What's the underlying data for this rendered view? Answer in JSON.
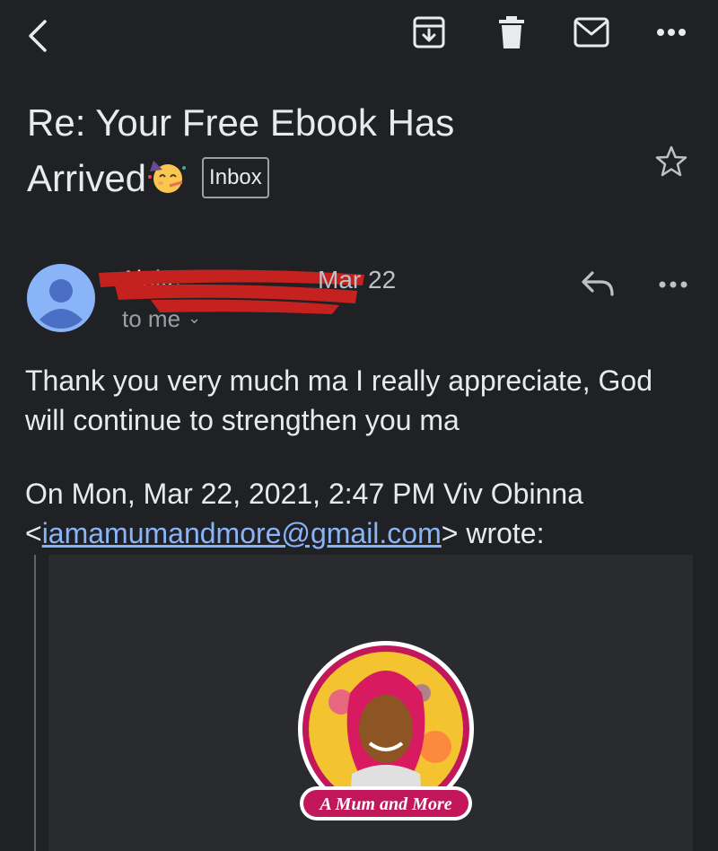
{
  "toolbar": {
    "back_icon": "chevron-left-icon",
    "archive_icon": "archive-icon",
    "delete_icon": "trash-icon",
    "mark_unread_icon": "mail-icon",
    "more_icon": "more-horizontal-icon"
  },
  "subject": {
    "line1": "Re: Your Free Ebook Has",
    "line2": "Arrived",
    "emoji": "partying-face-emoji",
    "label": "Inbox",
    "star_icon": "star-outline-icon"
  },
  "message": {
    "sender_name": "Ajoke",
    "sender_redacted": true,
    "date": "Mar 22",
    "to": "to me",
    "reply_icon": "reply-icon",
    "more_icon": "more-horizontal-icon",
    "body": "Thank you very much ma I really appreciate, God will continue to strengthen you ma",
    "quote_intro": "On Mon, Mar 22, 2021, 2:47 PM Viv Obinna",
    "quote_lt": "<",
    "quote_email": "iamamumandmore@gmail.com",
    "quote_gt_wrote": "> wrote:"
  },
  "quoted": {
    "logo_text": "A Mum and More"
  },
  "colors": {
    "background": "#202124",
    "text": "#e8eaed",
    "secondary": "#9aa0a6",
    "link": "#8ab4f8",
    "avatar": "#8ab4f8",
    "redaction": "#c5221f",
    "logo_ring": "#c2185b",
    "logo_fill": "#f4c430"
  }
}
